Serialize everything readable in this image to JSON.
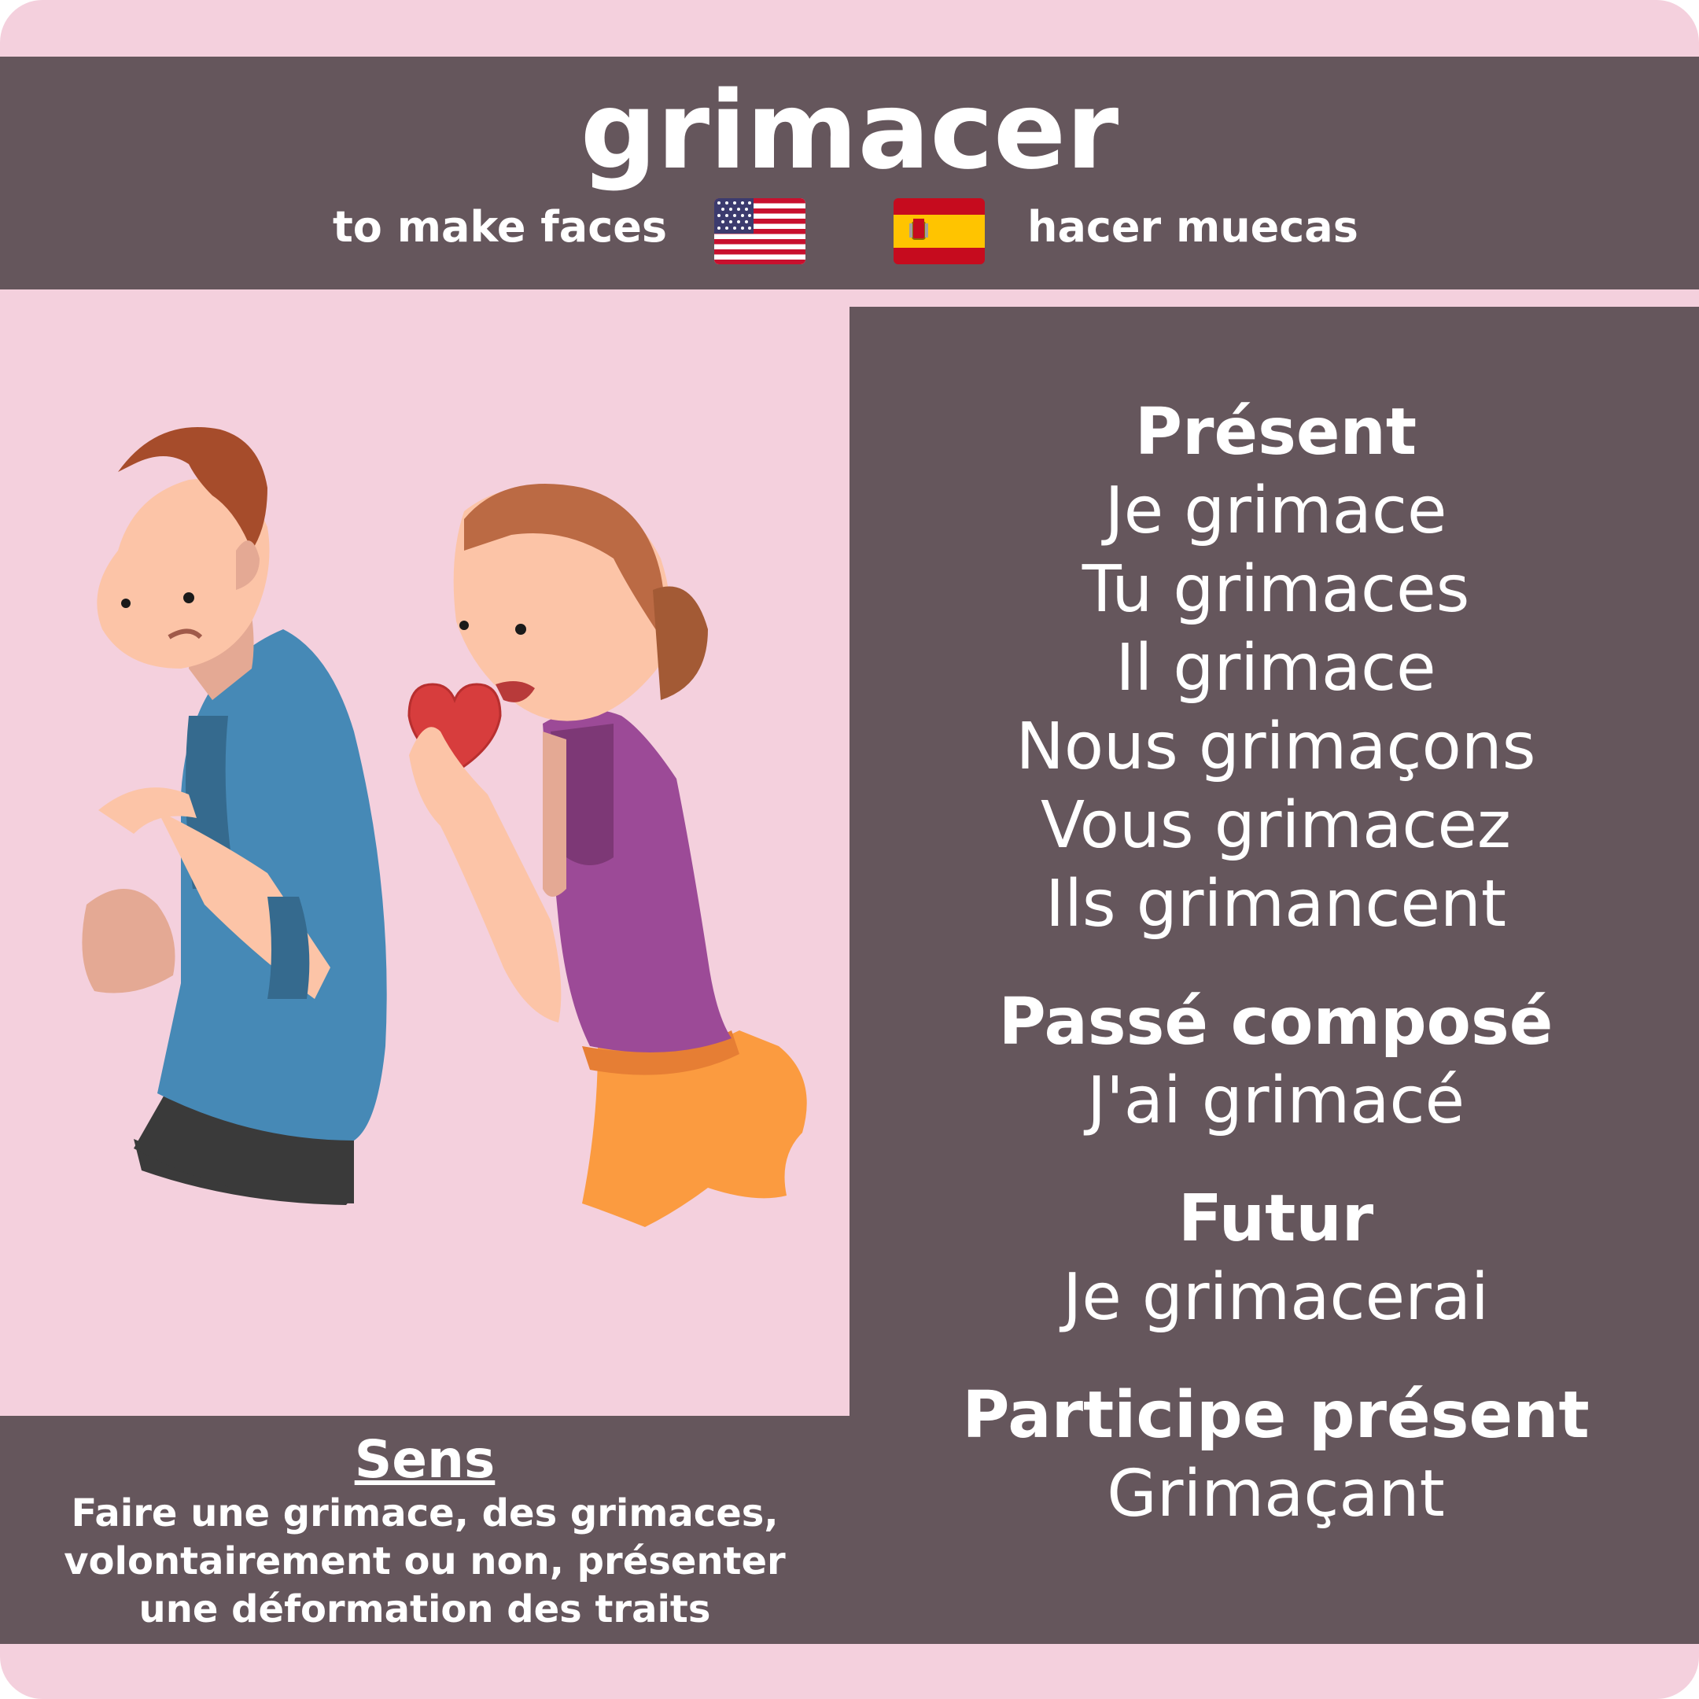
{
  "header": {
    "title": "grimacer",
    "translation_en": "to make faces",
    "translation_es": "hacer muecas",
    "flag_en": "us-flag-icon",
    "flag_es": "spain-flag-icon"
  },
  "colors": {
    "background": "#f4d0dd",
    "panel": "#65565c",
    "text": "#ffffff"
  },
  "illustration": {
    "subject": "boy and girl with heart illustration"
  },
  "conjugation": {
    "present": {
      "heading": "Présent",
      "forms": [
        "Je grimace",
        "Tu grimaces",
        "Il grimace",
        "Nous grimaçons",
        "Vous grimacez",
        "Ils grimancent"
      ]
    },
    "passe_compose": {
      "heading": "Passé composé",
      "form": "J'ai grimacé"
    },
    "futur": {
      "heading": "Futur",
      "form": "Je grimacerai"
    },
    "participe_present": {
      "heading": "Participe présent",
      "form": "Grimaçant"
    }
  },
  "sens": {
    "title": "Sens",
    "lines": [
      "Faire une grimace, des grimaces,",
      "volontairement ou non, présenter",
      "une déformation des traits"
    ]
  }
}
